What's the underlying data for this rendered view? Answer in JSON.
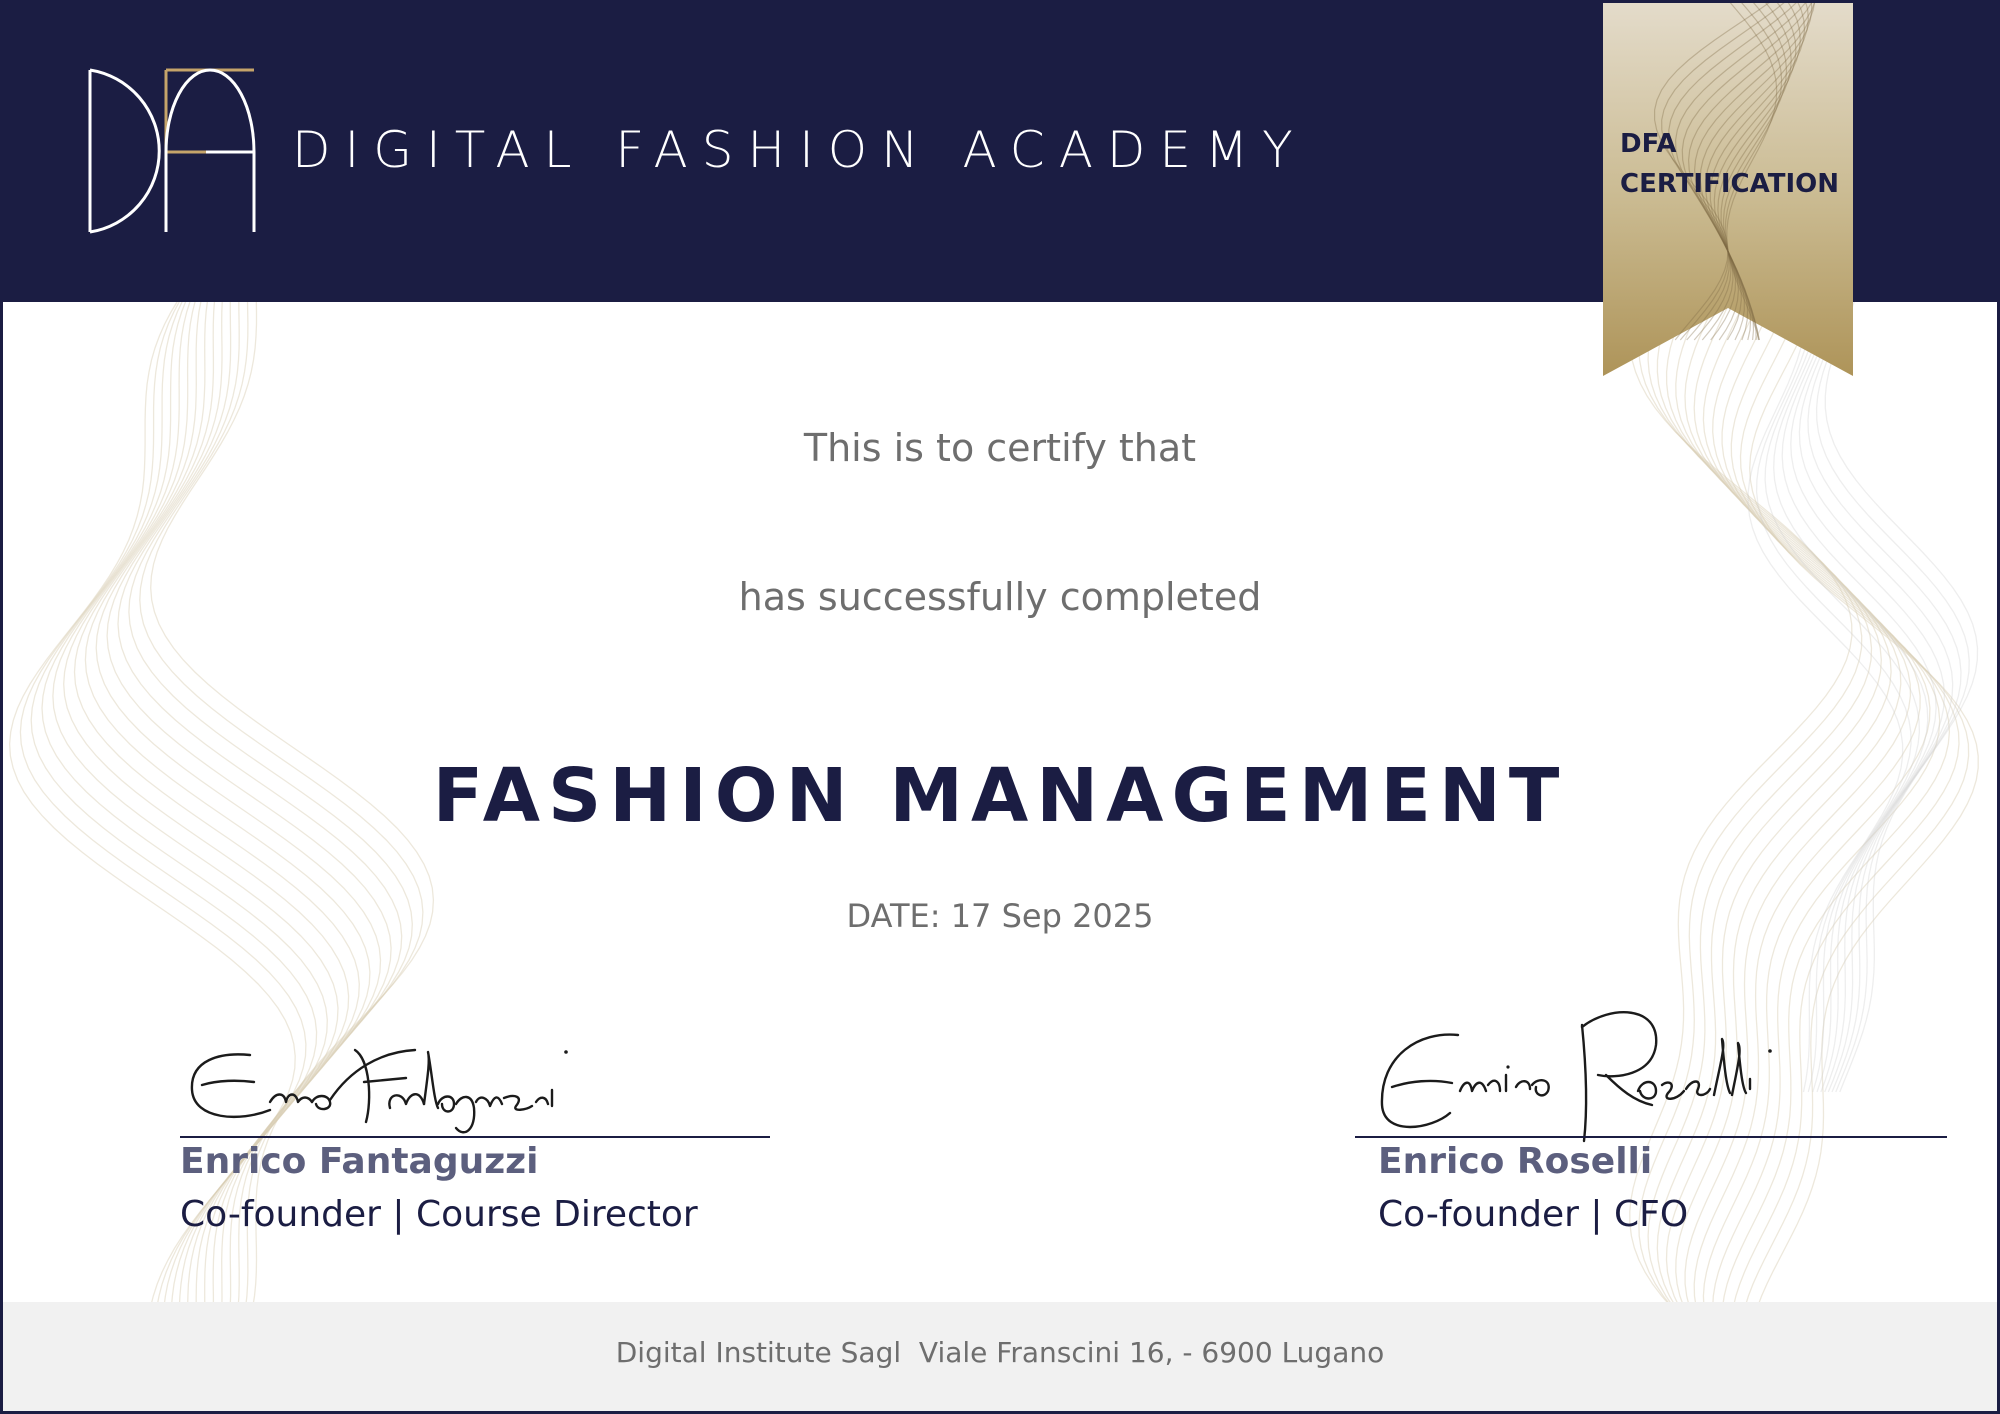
{
  "header": {
    "academy_name": "DIGITAL FASHION ACADEMY",
    "logo_icon": "dfa-monogram-logo",
    "background_color": "#1b1d43"
  },
  "badge": {
    "line1": "DFA",
    "line2": "CERTIFICATION",
    "color": "#b29a63"
  },
  "body": {
    "certify_text": "This is to certify that",
    "completed_text": "has successfully completed",
    "course_title": "FASHION MANAGEMENT",
    "date_text": "DATE: 17 Sep 2025"
  },
  "signatures": [
    {
      "name": "Enrico Fantaguzzi",
      "role": "Co-founder | Course Director",
      "signature_text": "Enrico Fantaguzzi"
    },
    {
      "name": "Enrico Roselli",
      "role": "Co-founder | CFO",
      "signature_text": "Enrico Roselli"
    }
  ],
  "footer": {
    "address": "Digital Institute Sagl  Viale Franscini 16, - 6900 Lugano"
  },
  "colors": {
    "navy": "#1b1d43",
    "gold": "#b29a63",
    "text_gray": "#6e6e6e",
    "name_gray": "#5c5f7e",
    "footer_bg": "#f1f1f1"
  }
}
